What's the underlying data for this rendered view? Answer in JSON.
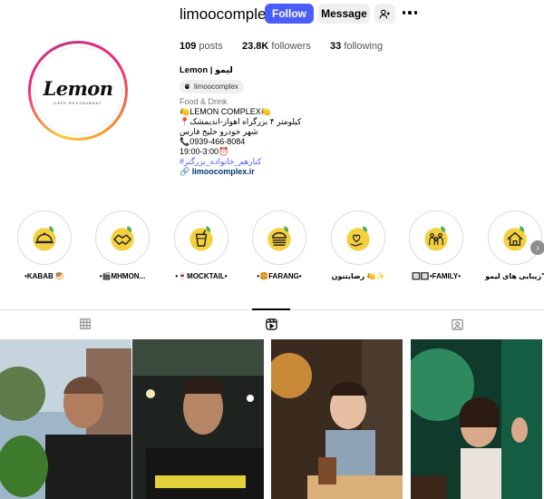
{
  "profile": {
    "username": "limoocomplex",
    "follow_label": "Follow",
    "message_label": "Message",
    "avatar": {
      "logo_text": "Lemon",
      "logo_subtext": "CAFE RESTAURANT"
    }
  },
  "stats": {
    "posts_count": "109",
    "posts_label": "posts",
    "followers_count": "23.8K",
    "followers_label": "followers",
    "following_count": "33",
    "following_label": "following"
  },
  "bio": {
    "name": "Lemon | لیمو",
    "threads_handle": "limoocomplex",
    "category": "Food & Drink",
    "lines": [
      "🍋LEMON COMPLEX🍋",
      "📍کیلومتر ۴ بزرگراه اهواز-اندیمشک",
      "شهر خودرو خلیج فارس",
      "📞0939-466-8084",
      "19:00-3:00⏰"
    ],
    "hashtag": "#کنارهم_خانواده_بزرگتر",
    "link": "limoocomplex.ir"
  },
  "highlights": [
    {
      "label": "•KABAB 🥙",
      "icon": "food-cloche-icon"
    },
    {
      "label": "•🎬MHMON...",
      "icon": "handshake-icon"
    },
    {
      "label": "•🍷MOCKTAIL•",
      "icon": "drink-cup-icon"
    },
    {
      "label": "•🍔FARANG•",
      "icon": "burger-icon"
    },
    {
      "label": "رضایتنون 🍋✨",
      "icon": "heart-hand-icon"
    },
    {
      "label": "🔲🔲•FAMILY•",
      "icon": "family-icon"
    },
    {
      "label": "زیبایی های لیمو\"",
      "icon": "home-icon"
    }
  ],
  "tabs": [
    {
      "name": "posts",
      "icon": "grid-icon"
    },
    {
      "name": "reels",
      "icon": "reels-icon",
      "active": true
    },
    {
      "name": "tagged",
      "icon": "tagged-icon"
    }
  ],
  "grid_posts": [
    {
      "description": "man with green plant"
    },
    {
      "description": "smiling man in black shirt"
    },
    {
      "description": "toddler at table with drink"
    },
    {
      "description": "girl waving in green light"
    }
  ],
  "colors": {
    "accent": "#4a5df9",
    "lemon_yellow": "#f1c40f",
    "button_grey": "#efefef"
  }
}
